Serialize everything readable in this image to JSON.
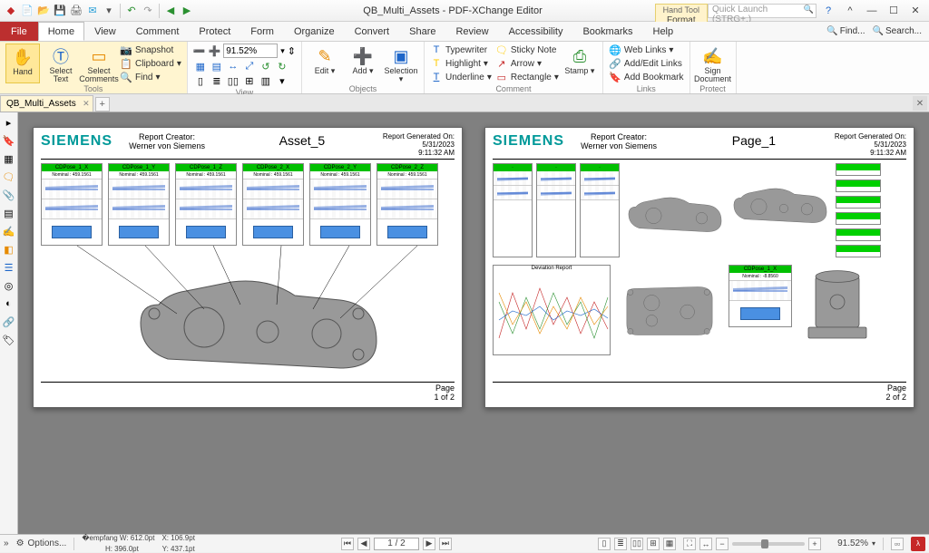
{
  "app": {
    "doc_title": "QB_Multi_Assets - PDF-XChange Editor",
    "context_tab_group": "Hand Tool",
    "context_tab": "Format",
    "quick_launch_placeholder": "Quick Launch (STRG+.)"
  },
  "menus": {
    "file": "File",
    "items": [
      "Home",
      "View",
      "Comment",
      "Protect",
      "Form",
      "Organize",
      "Convert",
      "Share",
      "Review",
      "Accessibility",
      "Bookmarks",
      "Help"
    ],
    "active": "Home",
    "find": "Find...",
    "search": "Search..."
  },
  "ribbon": {
    "tools": {
      "label": "Tools",
      "hand": "Hand",
      "select_text": "Select Text",
      "select_comments": "Select Comments",
      "snapshot": "Snapshot",
      "clipboard": "Clipboard",
      "find": "Find"
    },
    "view": {
      "label": "View",
      "zoom_value": "91.52%"
    },
    "objects": {
      "label": "Objects",
      "edit": "Edit",
      "add": "Add",
      "selection": "Selection"
    },
    "comment": {
      "label": "Comment",
      "typewriter": "Typewriter",
      "highlight": "Highlight",
      "underline": "Underline",
      "sticky": "Sticky Note",
      "arrow": "Arrow",
      "rectangle": "Rectangle",
      "stamp": "Stamp"
    },
    "links": {
      "label": "Links",
      "web": "Web Links",
      "addedit": "Add/Edit Links",
      "bookmark": "Add Bookmark"
    },
    "protect": {
      "label": "Protect",
      "sign": "Sign Document"
    }
  },
  "doctab": {
    "name": "QB_Multi_Assets"
  },
  "pages": {
    "p1": {
      "brand": "SIEMENS",
      "creator_label": "Report Creator:",
      "creator_name": "Werner von Siemens",
      "asset": "Asset_5",
      "gen_label": "Report Generated On:",
      "gen_date": "5/31/2023",
      "gen_time": "9:11:32 AM",
      "page_label": "Page",
      "page_num": "1 of 2",
      "chart_titles": [
        "CDPose_1_X",
        "CDPose_1_Y",
        "CDPose_1_Z",
        "CDPose_2_X",
        "CDPose_2_Y",
        "CDPose_2_Z"
      ],
      "chart_sub": "Nominal : 459.1561"
    },
    "p2": {
      "brand": "SIEMENS",
      "creator_label": "Report Creator:",
      "creator_name": "Werner von Siemens",
      "asset": "Page_1",
      "gen_label": "Report Generated On:",
      "gen_date": "5/31/2023",
      "gen_time": "9:11:32 AM",
      "page_label": "Page",
      "page_num": "2 of 2",
      "dev_title": "Deviation Report",
      "box_title": "CDPose_1_X",
      "box_sub": "Nominal : -8.8560"
    }
  },
  "status": {
    "options": "Options...",
    "w": "W: 612.0pt",
    "h": "H: 396.0pt",
    "x": "X: 106.9pt",
    "y": "Y: 437.1pt",
    "page_current": "1 / 2",
    "zoom": "91.52%"
  }
}
